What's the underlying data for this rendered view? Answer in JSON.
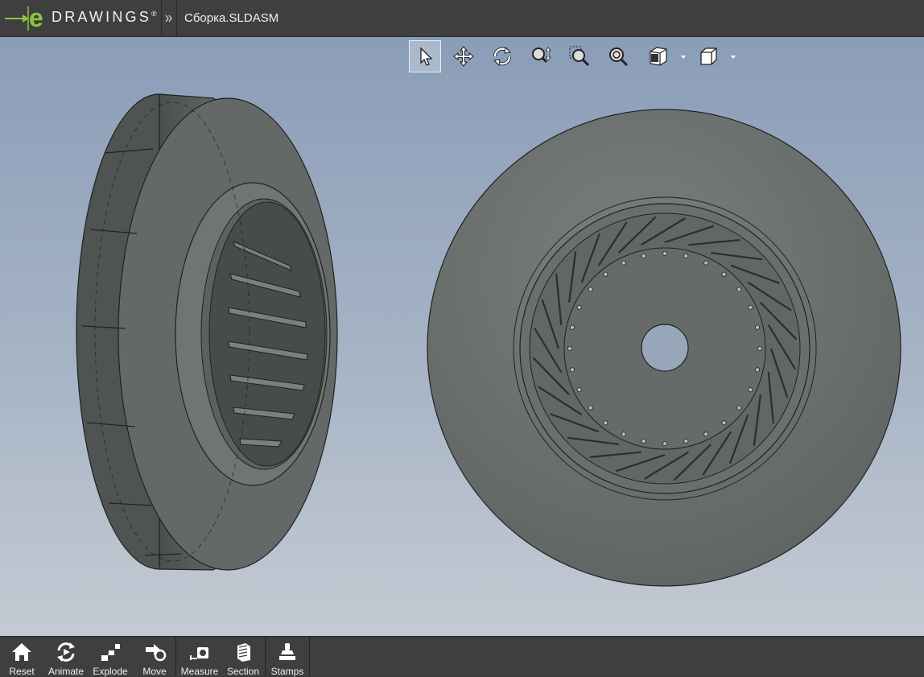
{
  "app": {
    "brand": "DRAWINGS",
    "brand_mark": "®",
    "document_title": "Сборка.SLDASM"
  },
  "toolbar": {
    "buttons": [
      {
        "name": "select-tool-button",
        "icon": "arrow-cursor-icon",
        "active": true
      },
      {
        "name": "pan-tool-button",
        "icon": "four-way-arrows-icon"
      },
      {
        "name": "rotate-tool-button",
        "icon": "rotate-icon"
      },
      {
        "name": "zoom-tool-button",
        "icon": "zoom-updown-icon"
      },
      {
        "name": "zoom-to-area-button",
        "icon": "zoom-area-icon"
      },
      {
        "name": "zoom-to-fit-button",
        "icon": "zoom-fit-icon"
      },
      {
        "name": "display-style-button",
        "icon": "display-style-icon",
        "dropdown": true
      },
      {
        "name": "view-orientation-button",
        "icon": "cube-icon",
        "dropdown": true
      }
    ]
  },
  "bottom_toolbar": {
    "items": [
      {
        "name": "reset",
        "label": "Reset",
        "icon": "home-icon"
      },
      {
        "name": "animate",
        "label": "Animate",
        "icon": "animate-icon"
      },
      {
        "name": "explode",
        "label": "Explode",
        "icon": "explode-icon"
      },
      {
        "name": "move",
        "label": "Move",
        "icon": "move-icon"
      },
      {
        "name": "measure",
        "label": "Measure",
        "icon": "measure-icon"
      },
      {
        "name": "section",
        "label": "Section",
        "icon": "section-icon"
      },
      {
        "name": "stamps",
        "label": "Stamps",
        "icon": "stamp-icon"
      }
    ]
  },
  "colors": {
    "chrome": "#3f3f3f",
    "logo_green": "#8cc63f",
    "model_face": "#6c716f",
    "model_edge": "#1e2220",
    "viewport_top": "#8a9db8",
    "viewport_bottom": "#c4cad3"
  }
}
